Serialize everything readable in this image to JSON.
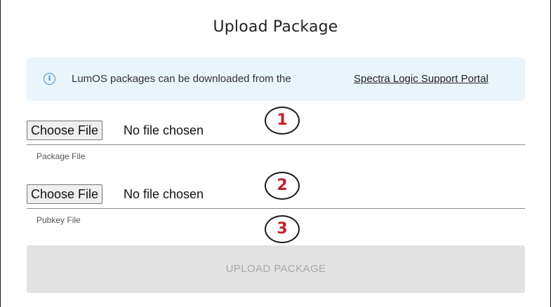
{
  "dialog": {
    "title": "Upload Package"
  },
  "info": {
    "icon": "info-circle-icon",
    "icon_glyph": "i",
    "text": "LumOS packages can be downloaded from the",
    "link_text": "Spectra Logic Support Portal",
    "accent_color": "#3b8fd1",
    "background_color": "#eaf4fb"
  },
  "package_file": {
    "button_label": "Choose File",
    "status": "No file chosen",
    "helper": "Package File"
  },
  "pubkey_file": {
    "button_label": "Choose File",
    "status": "No file chosen",
    "helper": "Pubkey File"
  },
  "callouts": [
    {
      "label": "1"
    },
    {
      "label": "2"
    },
    {
      "label": "3"
    }
  ],
  "callout_color": "#c0202a",
  "upload_button": {
    "label": "UPLOAD PACKAGE",
    "disabled": true
  }
}
